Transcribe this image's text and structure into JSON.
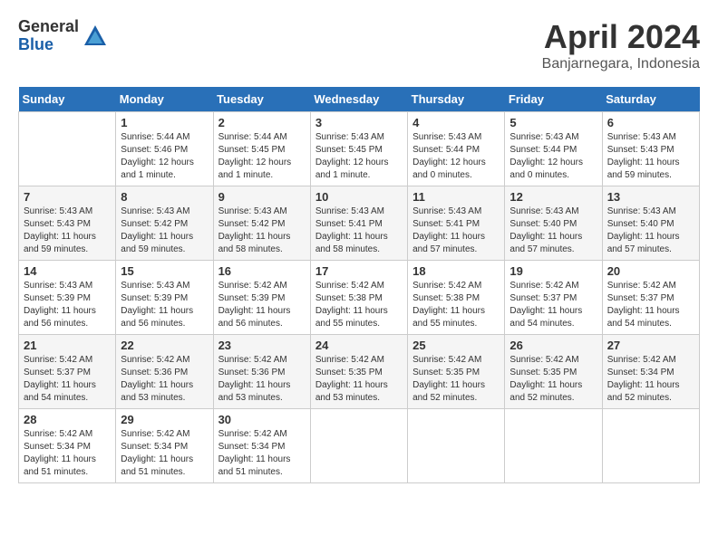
{
  "header": {
    "logo_general": "General",
    "logo_blue": "Blue",
    "month_title": "April 2024",
    "location": "Banjarnegara, Indonesia"
  },
  "days_of_week": [
    "Sunday",
    "Monday",
    "Tuesday",
    "Wednesday",
    "Thursday",
    "Friday",
    "Saturday"
  ],
  "weeks": [
    [
      {
        "num": "",
        "sunrise": "",
        "sunset": "",
        "daylight": ""
      },
      {
        "num": "1",
        "sunrise": "Sunrise: 5:44 AM",
        "sunset": "Sunset: 5:46 PM",
        "daylight": "Daylight: 12 hours and 1 minute."
      },
      {
        "num": "2",
        "sunrise": "Sunrise: 5:44 AM",
        "sunset": "Sunset: 5:45 PM",
        "daylight": "Daylight: 12 hours and 1 minute."
      },
      {
        "num": "3",
        "sunrise": "Sunrise: 5:43 AM",
        "sunset": "Sunset: 5:45 PM",
        "daylight": "Daylight: 12 hours and 1 minute."
      },
      {
        "num": "4",
        "sunrise": "Sunrise: 5:43 AM",
        "sunset": "Sunset: 5:44 PM",
        "daylight": "Daylight: 12 hours and 0 minutes."
      },
      {
        "num": "5",
        "sunrise": "Sunrise: 5:43 AM",
        "sunset": "Sunset: 5:44 PM",
        "daylight": "Daylight: 12 hours and 0 minutes."
      },
      {
        "num": "6",
        "sunrise": "Sunrise: 5:43 AM",
        "sunset": "Sunset: 5:43 PM",
        "daylight": "Daylight: 11 hours and 59 minutes."
      }
    ],
    [
      {
        "num": "7",
        "sunrise": "Sunrise: 5:43 AM",
        "sunset": "Sunset: 5:43 PM",
        "daylight": "Daylight: 11 hours and 59 minutes."
      },
      {
        "num": "8",
        "sunrise": "Sunrise: 5:43 AM",
        "sunset": "Sunset: 5:42 PM",
        "daylight": "Daylight: 11 hours and 59 minutes."
      },
      {
        "num": "9",
        "sunrise": "Sunrise: 5:43 AM",
        "sunset": "Sunset: 5:42 PM",
        "daylight": "Daylight: 11 hours and 58 minutes."
      },
      {
        "num": "10",
        "sunrise": "Sunrise: 5:43 AM",
        "sunset": "Sunset: 5:41 PM",
        "daylight": "Daylight: 11 hours and 58 minutes."
      },
      {
        "num": "11",
        "sunrise": "Sunrise: 5:43 AM",
        "sunset": "Sunset: 5:41 PM",
        "daylight": "Daylight: 11 hours and 57 minutes."
      },
      {
        "num": "12",
        "sunrise": "Sunrise: 5:43 AM",
        "sunset": "Sunset: 5:40 PM",
        "daylight": "Daylight: 11 hours and 57 minutes."
      },
      {
        "num": "13",
        "sunrise": "Sunrise: 5:43 AM",
        "sunset": "Sunset: 5:40 PM",
        "daylight": "Daylight: 11 hours and 57 minutes."
      }
    ],
    [
      {
        "num": "14",
        "sunrise": "Sunrise: 5:43 AM",
        "sunset": "Sunset: 5:39 PM",
        "daylight": "Daylight: 11 hours and 56 minutes."
      },
      {
        "num": "15",
        "sunrise": "Sunrise: 5:43 AM",
        "sunset": "Sunset: 5:39 PM",
        "daylight": "Daylight: 11 hours and 56 minutes."
      },
      {
        "num": "16",
        "sunrise": "Sunrise: 5:42 AM",
        "sunset": "Sunset: 5:39 PM",
        "daylight": "Daylight: 11 hours and 56 minutes."
      },
      {
        "num": "17",
        "sunrise": "Sunrise: 5:42 AM",
        "sunset": "Sunset: 5:38 PM",
        "daylight": "Daylight: 11 hours and 55 minutes."
      },
      {
        "num": "18",
        "sunrise": "Sunrise: 5:42 AM",
        "sunset": "Sunset: 5:38 PM",
        "daylight": "Daylight: 11 hours and 55 minutes."
      },
      {
        "num": "19",
        "sunrise": "Sunrise: 5:42 AM",
        "sunset": "Sunset: 5:37 PM",
        "daylight": "Daylight: 11 hours and 54 minutes."
      },
      {
        "num": "20",
        "sunrise": "Sunrise: 5:42 AM",
        "sunset": "Sunset: 5:37 PM",
        "daylight": "Daylight: 11 hours and 54 minutes."
      }
    ],
    [
      {
        "num": "21",
        "sunrise": "Sunrise: 5:42 AM",
        "sunset": "Sunset: 5:37 PM",
        "daylight": "Daylight: 11 hours and 54 minutes."
      },
      {
        "num": "22",
        "sunrise": "Sunrise: 5:42 AM",
        "sunset": "Sunset: 5:36 PM",
        "daylight": "Daylight: 11 hours and 53 minutes."
      },
      {
        "num": "23",
        "sunrise": "Sunrise: 5:42 AM",
        "sunset": "Sunset: 5:36 PM",
        "daylight": "Daylight: 11 hours and 53 minutes."
      },
      {
        "num": "24",
        "sunrise": "Sunrise: 5:42 AM",
        "sunset": "Sunset: 5:35 PM",
        "daylight": "Daylight: 11 hours and 53 minutes."
      },
      {
        "num": "25",
        "sunrise": "Sunrise: 5:42 AM",
        "sunset": "Sunset: 5:35 PM",
        "daylight": "Daylight: 11 hours and 52 minutes."
      },
      {
        "num": "26",
        "sunrise": "Sunrise: 5:42 AM",
        "sunset": "Sunset: 5:35 PM",
        "daylight": "Daylight: 11 hours and 52 minutes."
      },
      {
        "num": "27",
        "sunrise": "Sunrise: 5:42 AM",
        "sunset": "Sunset: 5:34 PM",
        "daylight": "Daylight: 11 hours and 52 minutes."
      }
    ],
    [
      {
        "num": "28",
        "sunrise": "Sunrise: 5:42 AM",
        "sunset": "Sunset: 5:34 PM",
        "daylight": "Daylight: 11 hours and 51 minutes."
      },
      {
        "num": "29",
        "sunrise": "Sunrise: 5:42 AM",
        "sunset": "Sunset: 5:34 PM",
        "daylight": "Daylight: 11 hours and 51 minutes."
      },
      {
        "num": "30",
        "sunrise": "Sunrise: 5:42 AM",
        "sunset": "Sunset: 5:34 PM",
        "daylight": "Daylight: 11 hours and 51 minutes."
      },
      {
        "num": "",
        "sunrise": "",
        "sunset": "",
        "daylight": ""
      },
      {
        "num": "",
        "sunrise": "",
        "sunset": "",
        "daylight": ""
      },
      {
        "num": "",
        "sunrise": "",
        "sunset": "",
        "daylight": ""
      },
      {
        "num": "",
        "sunrise": "",
        "sunset": "",
        "daylight": ""
      }
    ]
  ]
}
